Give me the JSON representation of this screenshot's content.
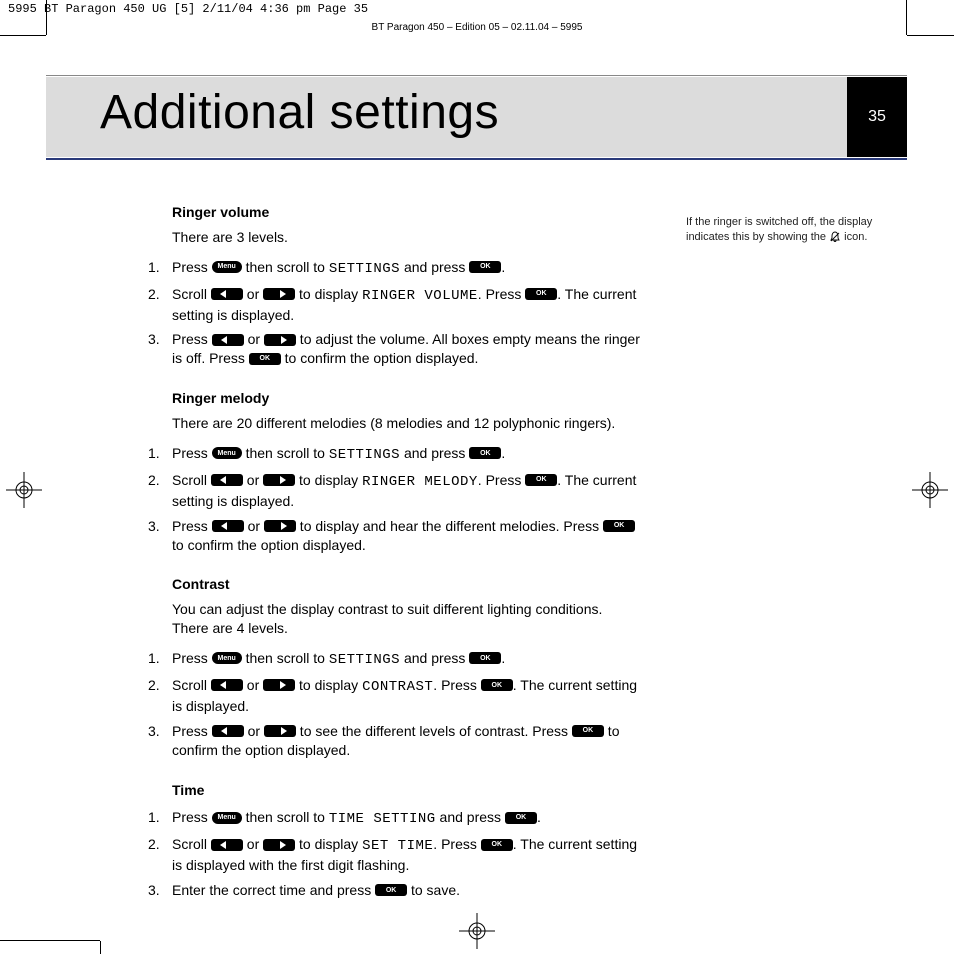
{
  "meta": {
    "jobline": "5995 BT Paragon 450 UG [5]  2/11/04  4:36 pm  Page 35",
    "edition": "BT Paragon 450 – Edition 05 – 02.11.04 – 5995"
  },
  "title": "Additional settings",
  "page_number": "35",
  "mono": {
    "settings": "SETTINGS",
    "ringer_volume": "RINGER VOLUME",
    "ringer_melody": "RINGER MELODY",
    "contrast": "CONTRAST",
    "time_setting": "TIME SETTING",
    "set_time": "SET TIME"
  },
  "sidenote": {
    "line1": "If the ringer is switched off, the display",
    "line2a": "indicates this by showing the ",
    "line2b": " icon."
  },
  "s1": {
    "heading": "Ringer volume",
    "intro": "There are 3 levels.",
    "st1a": "Press ",
    "st1b": " then scroll to ",
    "st1c": " and press ",
    "st1d": ".",
    "st2a": "Scroll ",
    "or": " or ",
    "st2b": " to display ",
    "st2c": ". Press ",
    "st2d": ". The current setting is displayed.",
    "st3a": "Press ",
    "st3b": " to adjust the volume. All boxes empty means the ringer is off. Press ",
    "st3c": " to confirm the option displayed."
  },
  "s2": {
    "heading": "Ringer melody",
    "intro": "There are 20 different melodies (8 melodies and 12 polyphonic ringers).",
    "st2d": ". The current setting is displayed.",
    "st3b": " to display and hear the different melodies. Press ",
    "st3c": " to confirm the option displayed."
  },
  "s3": {
    "heading": "Contrast",
    "intro": "You can adjust the display contrast to suit different lighting conditions. There are 4 levels.",
    "st2d": ". The current setting is displayed.",
    "st3b": " to see the different levels of contrast. Press ",
    "st3c": " to confirm the option displayed."
  },
  "s4": {
    "heading": "Time",
    "st2d": ". The current setting is displayed with the first digit flashing.",
    "st3a": "Enter the correct time and press ",
    "st3b": " to save."
  },
  "labels": {
    "menu": "Menu",
    "ok": "OK"
  }
}
